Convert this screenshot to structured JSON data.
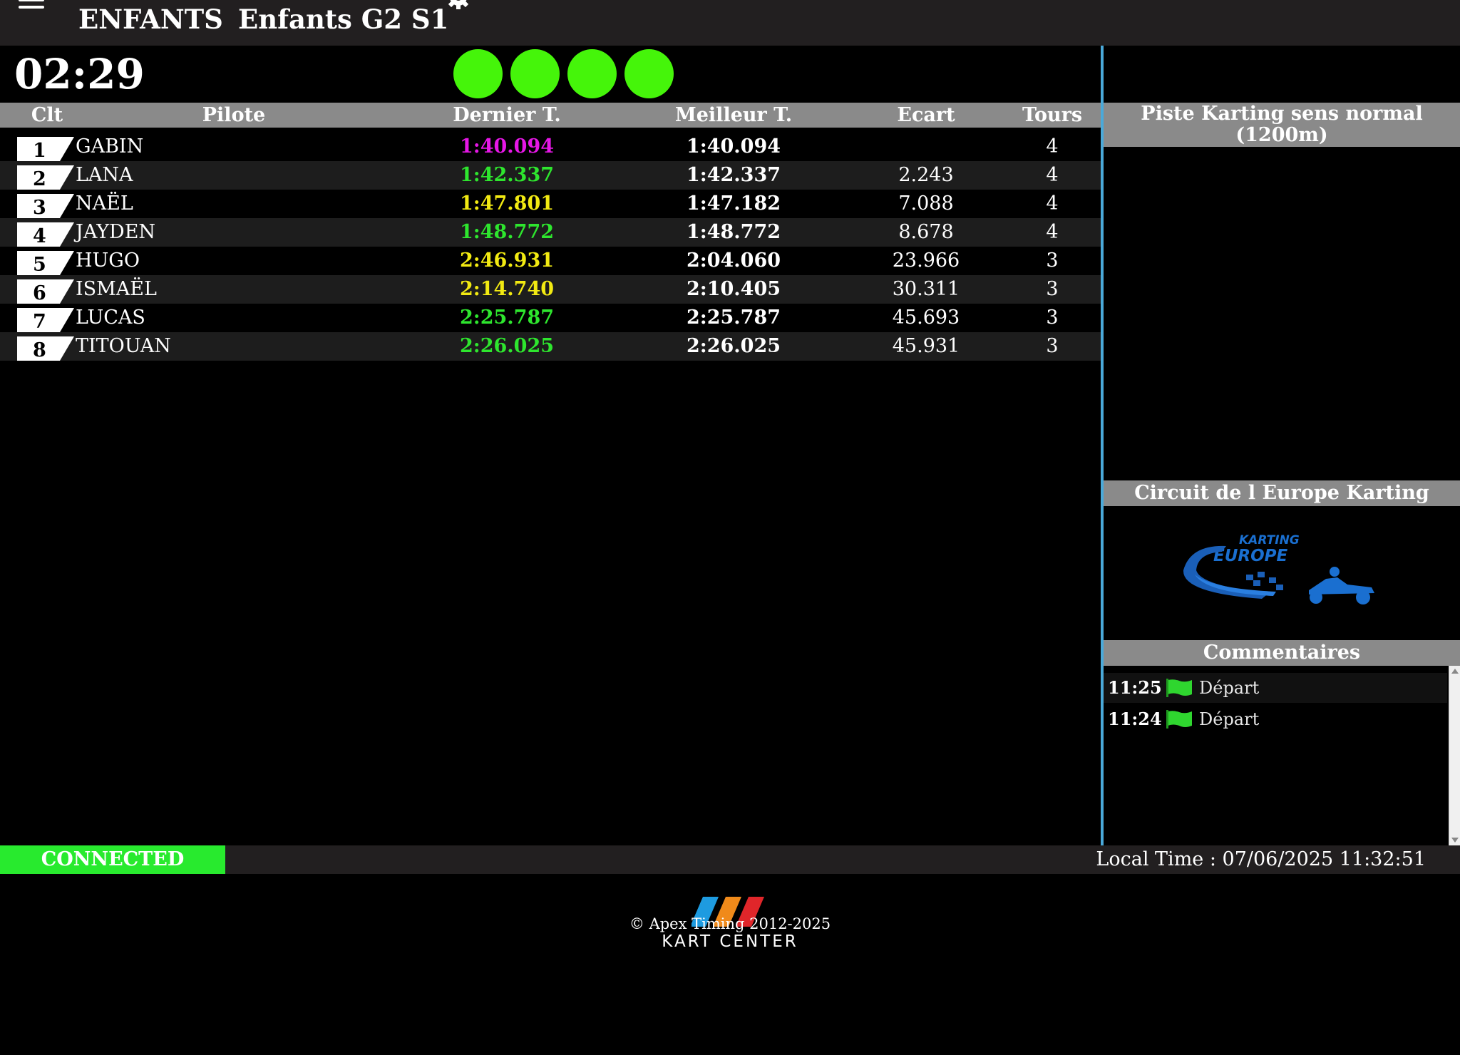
{
  "header": {
    "category": "ENFANTS",
    "session": "Enfants G2 S1"
  },
  "timer": "02:29",
  "lights": {
    "count": 4,
    "color": "#45f50a"
  },
  "table": {
    "headers": {
      "clt": "Clt",
      "pilote": "Pilote",
      "dernier": "Dernier T.",
      "meilleur": "Meilleur T.",
      "ecart": "Ecart",
      "tours": "Tours"
    },
    "rows": [
      {
        "pos": "1",
        "name": "GABIN",
        "last": "1:40.094",
        "last_color": "#e617e6",
        "best": "1:40.094",
        "gap": "",
        "laps": "4"
      },
      {
        "pos": "2",
        "name": "LANA",
        "last": "1:42.337",
        "last_color": "#2ee62e",
        "best": "1:42.337",
        "gap": "2.243",
        "laps": "4"
      },
      {
        "pos": "3",
        "name": "NAËL",
        "last": "1:47.801",
        "last_color": "#f2ea12",
        "best": "1:47.182",
        "gap": "7.088",
        "laps": "4"
      },
      {
        "pos": "4",
        "name": "JAYDEN",
        "last": "1:48.772",
        "last_color": "#2ee62e",
        "best": "1:48.772",
        "gap": "8.678",
        "laps": "4"
      },
      {
        "pos": "5",
        "name": "HUGO",
        "last": "2:46.931",
        "last_color": "#f2ea12",
        "best": "2:04.060",
        "gap": "23.966",
        "laps": "3"
      },
      {
        "pos": "6",
        "name": "ISMAËL",
        "last": "2:14.740",
        "last_color": "#f2ea12",
        "best": "2:10.405",
        "gap": "30.311",
        "laps": "3"
      },
      {
        "pos": "7",
        "name": "LUCAS",
        "last": "2:25.787",
        "last_color": "#2ee62e",
        "best": "2:25.787",
        "gap": "45.693",
        "laps": "3"
      },
      {
        "pos": "8",
        "name": "TITOUAN",
        "last": "2:26.025",
        "last_color": "#2ee62e",
        "best": "2:26.025",
        "gap": "45.931",
        "laps": "3"
      }
    ]
  },
  "side": {
    "track_title": "Piste Karting sens normal (1200m)",
    "circuit_title": "Circuit de l Europe Karting",
    "logo_top": "KARTING",
    "logo_main": "EUROPE",
    "comments_title": "Commentaires",
    "comments": [
      {
        "time": "11:25",
        "icon": "green-flag-icon",
        "text": "Départ"
      },
      {
        "time": "11:24",
        "icon": "green-flag-icon",
        "text": "Départ"
      }
    ]
  },
  "status": {
    "connection": "CONNECTED",
    "connection_color": "#28ea2e",
    "local_time": "Local Time : 07/06/2025 11:32:51"
  },
  "footer": {
    "copyright": "© Apex Timing 2012-2025",
    "brand": "KART CENTER"
  },
  "colors": {
    "accent_divider": "#4aa9d9",
    "header_bg": "#221f20",
    "table_header_bg": "#8a8a8a"
  }
}
